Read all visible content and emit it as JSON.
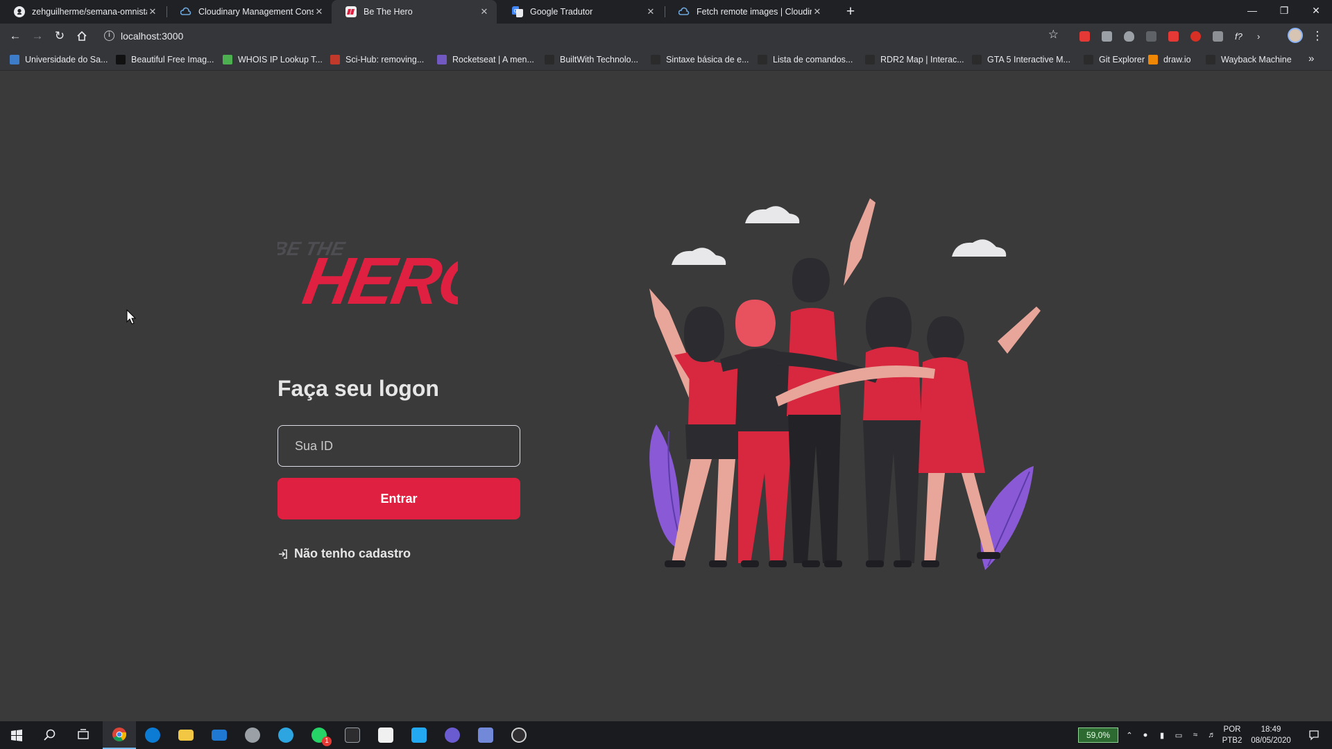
{
  "browser": {
    "tabs": [
      {
        "title": "zehguilherme/semana-omnistack",
        "icon": "github-icon",
        "active": false
      },
      {
        "title": "Cloudinary Management Console",
        "icon": "cloudinary-icon",
        "active": false
      },
      {
        "title": "Be The Hero",
        "icon": "be-the-hero-favicon",
        "active": true
      },
      {
        "title": "Google Tradutor",
        "icon": "google-translate-icon",
        "active": false
      },
      {
        "title": "Fetch remote images | Cloudinary",
        "icon": "cloudinary-icon",
        "active": false
      }
    ],
    "new_tab_label": "+",
    "close_glyph": "✕",
    "url": "localhost:3000",
    "bookmarks": [
      {
        "label": "Universidade do Sa...",
        "color": "#3d7cc9"
      },
      {
        "label": "Beautiful Free Imag...",
        "color": "#111111"
      },
      {
        "label": "WHOIS IP Lookup T...",
        "color": "#4caf50"
      },
      {
        "label": "Sci-Hub: removing...",
        "color": "#c0392b"
      },
      {
        "label": "Rocketseat | A men...",
        "color": "#7159c1"
      },
      {
        "label": "BuiltWith Technolo...",
        "color": "#2a2a2a"
      },
      {
        "label": "Sintaxe básica de e...",
        "color": "#2b2b2b"
      },
      {
        "label": "Lista de comandos...",
        "color": "#2b2b2b"
      },
      {
        "label": "RDR2 Map | Interac...",
        "color": "#2b2b2b"
      },
      {
        "label": "GTA 5 Interactive M...",
        "color": "#2b2b2b"
      },
      {
        "label": "Git Explorer",
        "color": "#2b2b2b"
      },
      {
        "label": "draw.io",
        "color": "#f08705"
      },
      {
        "label": "Wayback Machine",
        "color": "#2b2b2b"
      }
    ],
    "bookmarks_overflow": "»"
  },
  "page": {
    "logo_small": "BE THE",
    "logo_big": "HERO",
    "heading": "Faça seu logon",
    "id_placeholder": "Sua ID",
    "submit_label": "Entrar",
    "register_link": "Não tenho cadastro",
    "accent_color": "#e02041"
  },
  "taskbar": {
    "apps": [
      "windows-start-icon",
      "search-icon",
      "task-view-icon",
      "chrome-icon",
      "edge-icon",
      "file-explorer-icon",
      "mail-icon",
      "app-icon",
      "telegram-icon",
      "whatsapp-icon",
      "terminal-icon",
      "notion-icon",
      "vscode-icon",
      "app-icon",
      "discord-icon",
      "obs-icon"
    ],
    "whatsapp_badge": "1",
    "zoom_readout": "59,0%",
    "language": "POR",
    "keyboard": "PTB2",
    "time": "18:49",
    "date": "08/05/2020"
  }
}
